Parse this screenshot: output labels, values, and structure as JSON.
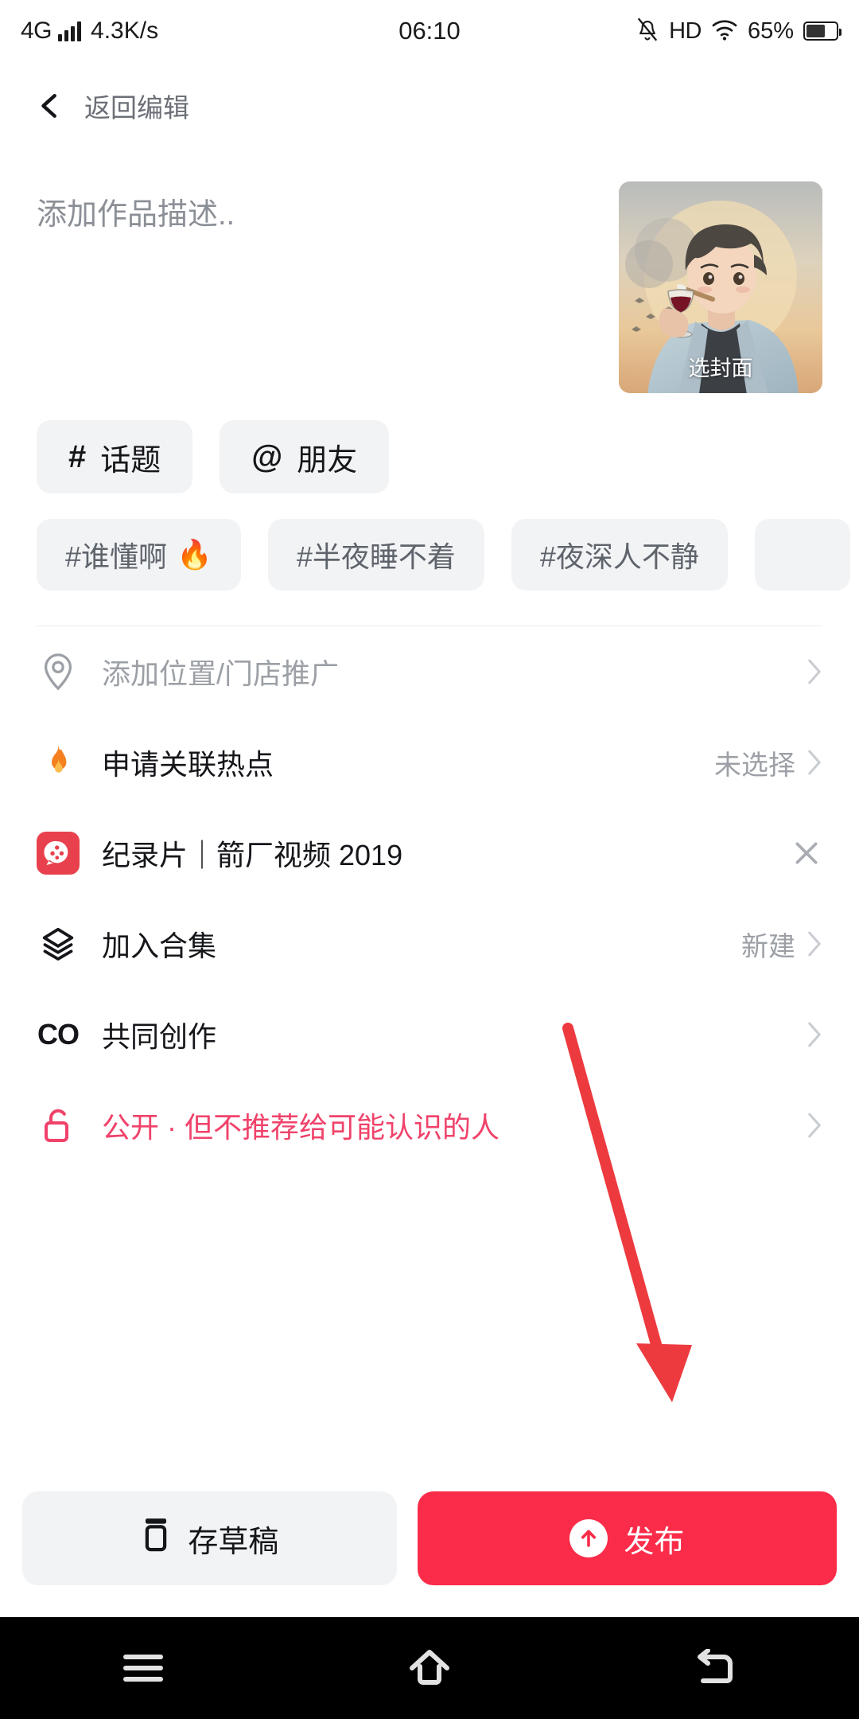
{
  "status_bar": {
    "network": "4G",
    "speed": "4.3K/s",
    "time": "06:10",
    "hd": "HD",
    "battery_percent": "65%",
    "icons": [
      "signal-bars-icon",
      "mute-icon",
      "hd-icon",
      "wifi-icon",
      "battery-icon"
    ]
  },
  "header": {
    "back_label": "返回编辑",
    "back_icon": "chevron-left-icon"
  },
  "description": {
    "placeholder": "添加作品描述..",
    "value": ""
  },
  "cover": {
    "label": "选封面"
  },
  "insert_chips": [
    {
      "symbol": "#",
      "label": "话题",
      "name": "topic"
    },
    {
      "symbol": "@",
      "label": "朋友",
      "name": "friend"
    }
  ],
  "suggested_tags": [
    {
      "label": "#谁懂啊",
      "hot": "🔥"
    },
    {
      "label": "#半夜睡不着",
      "hot": ""
    },
    {
      "label": "#夜深人不静",
      "hot": ""
    },
    {
      "label": "",
      "hot": ""
    }
  ],
  "rows": [
    {
      "name": "location",
      "icon": "location-pin-icon",
      "label": "添加位置/门店推广",
      "label_style": "muted",
      "value": "",
      "trailing": "chevron"
    },
    {
      "name": "hotspot",
      "icon": "flame-icon",
      "label": "申请关联热点",
      "label_style": "normal",
      "value": "未选择",
      "trailing": "chevron"
    },
    {
      "name": "linked-content",
      "icon": "film-reel-icon",
      "label": "纪录片｜箭厂视频 2019",
      "label_style": "normal",
      "value": "",
      "trailing": "close"
    },
    {
      "name": "collection",
      "icon": "layers-icon",
      "label": "加入合集",
      "label_style": "normal",
      "value": "新建",
      "trailing": "chevron"
    },
    {
      "name": "co-creation",
      "icon": "co-icon",
      "label": "共同创作",
      "label_style": "normal",
      "value": "",
      "trailing": "chevron"
    },
    {
      "name": "visibility",
      "icon": "unlock-icon",
      "label": "公开 · 但不推荐给可能认识的人",
      "label_style": "pink",
      "value": "",
      "trailing": "chevron"
    }
  ],
  "bottom": {
    "draft_label": "存草稿",
    "draft_icon": "draft-box-icon",
    "publish_label": "发布",
    "publish_icon": "arrow-up-circle-icon"
  },
  "nav_bar": {
    "menu_icon": "menu-icon",
    "home_icon": "home-icon",
    "back_icon": "back-icon"
  },
  "colors": {
    "accent_red": "#fa2c49",
    "pink_text": "#f0426a",
    "chip_bg": "#f2f3f5",
    "muted_text": "#9ca0a6",
    "annotation_red": "#ed3a3f"
  }
}
